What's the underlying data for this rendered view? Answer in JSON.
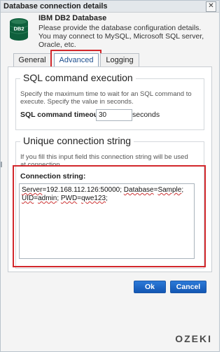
{
  "window": {
    "title": "Database connection details",
    "close_glyph": "✕"
  },
  "header": {
    "icon_name": "db2-database-icon",
    "icon_text": "DB2",
    "title": "IBM DB2 Database",
    "description": "Please provide the database configuration details. You may connect to MySQL, Microsoft SQL server, Oracle, etc."
  },
  "tabs": [
    {
      "label": "General"
    },
    {
      "label": "Advanced",
      "active": true
    },
    {
      "label": "Logging"
    }
  ],
  "sql_section": {
    "title": "SQL command execution",
    "help": "Specify the maximum time to wait for an SQL command to execute. Specify the value in seconds.",
    "timeout_label": "SQL command timeout:",
    "timeout_value": "30",
    "unit": "seconds"
  },
  "conn_section": {
    "title": "Unique connection string",
    "help": "If you fill this input field this connection string will be used at connection.",
    "conn_label": "Connection string:",
    "conn_line1_a": "Server",
    "conn_line1_b": "=192.168.112.126:50000; ",
    "conn_line1_c": "Database",
    "conn_line1_d": "=",
    "conn_line1_e": "Sample",
    "conn_line1_f": ";",
    "conn_line2_a": "UID",
    "conn_line2_b": "=",
    "conn_line2_c": "admin",
    "conn_line2_d": "; ",
    "conn_line2_e": "PWD",
    "conn_line2_f": "=",
    "conn_line2_g": "qwe123",
    "conn_line2_h": ";"
  },
  "buttons": {
    "ok": "Ok",
    "cancel": "Cancel"
  },
  "branding": {
    "logo": "OZEKI"
  },
  "colors": {
    "highlight": "#d2282c",
    "button": "#1f67c6",
    "tab_active_text": "#1d4f8f"
  }
}
